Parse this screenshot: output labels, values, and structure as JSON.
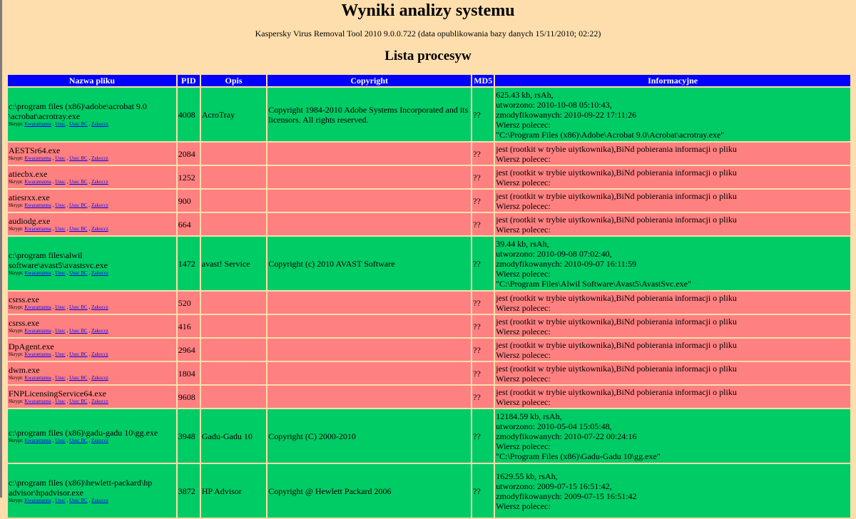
{
  "page": {
    "title": "Wyniki analizy systemu",
    "subtitle": "Kaspersky Virus Removal Tool 2010 9.0.0.722 (data opublikowania bazy danych 15/11/2010; 02:22)",
    "section_title": "Lista procesyw"
  },
  "table": {
    "headers": [
      "Nazwa pliku",
      "PID",
      "Opis",
      "Copyright",
      "MD5",
      "Informacyjne"
    ],
    "script_label": "Skrypt:",
    "actions": [
      "Kwarantanna",
      "Usuc",
      "Usuc BC",
      "Zakoccz"
    ],
    "rows": [
      {
        "status": "ok",
        "file_lines": [
          "c:\\program files (x86)\\adobe\\acrobat 9.0",
          "\\acrobat\\acrotray.exe"
        ],
        "pid": "4008",
        "desc": "AcroTray",
        "copyright": "Copyright 1984-2010 Adobe Systems Incorporated and its licensors. All rights reserved.",
        "md5": "??",
        "info": [
          "625.43 kb, rsAh,",
          "utworzono: 2010-10-08 05:10:43,",
          "zmodyfikowanych: 2010-09-22 17:11:26",
          "Wiersz polecec:",
          "\"C:\\Program Files (x86)\\Adobe\\Acrobat 9.0\\Acrobat\\acrotray.exe\""
        ]
      },
      {
        "status": "bad",
        "file_lines": [
          "AESTSr64.exe"
        ],
        "pid": "2084",
        "desc": "",
        "copyright": "",
        "md5": "??",
        "info": [
          "jest (rootkit w trybie uiytkownika),BiNd pobierania informacji o pliku",
          "Wiersz polecec:"
        ]
      },
      {
        "status": "bad",
        "file_lines": [
          "atiecbx.exe"
        ],
        "pid": "1252",
        "desc": "",
        "copyright": "",
        "md5": "??",
        "info": [
          "jest (rootkit w trybie uiytkownika),BiNd pobierania informacji o pliku",
          "Wiersz polecec:"
        ]
      },
      {
        "status": "bad",
        "file_lines": [
          "atiesrxx.exe"
        ],
        "pid": "900",
        "desc": "",
        "copyright": "",
        "md5": "??",
        "info": [
          "jest (rootkit w trybie uiytkownika),BiNd pobierania informacji o pliku",
          "Wiersz polecec:"
        ]
      },
      {
        "status": "bad",
        "file_lines": [
          "audiodg.exe"
        ],
        "pid": "664",
        "desc": "",
        "copyright": "",
        "md5": "??",
        "info": [
          "jest (rootkit w trybie uiytkownika),BiNd pobierania informacji o pliku",
          "Wiersz polecec:"
        ]
      },
      {
        "status": "ok",
        "file_lines": [
          "c:\\program files\\alwil software\\avast5\\avastsvc.exe"
        ],
        "pid": "1472",
        "desc": "avast! Service",
        "copyright": "Copyright (c) 2010 AVAST Software",
        "md5": "??",
        "info": [
          "39.44 kb, rsAh,",
          "utworzono: 2010-09-08 07:02:40,",
          "zmodyfikowanych: 2010-09-07 16:11:59",
          "Wiersz polecec:",
          "\"C:\\Program Files\\Alwil Software\\Avast5\\AvastSvc.exe\""
        ]
      },
      {
        "status": "bad",
        "file_lines": [
          "csrss.exe"
        ],
        "pid": "520",
        "desc": "",
        "copyright": "",
        "md5": "??",
        "info": [
          "jest (rootkit w trybie uiytkownika),BiNd pobierania informacji o pliku",
          "Wiersz polecec:"
        ]
      },
      {
        "status": "bad",
        "file_lines": [
          "csrss.exe"
        ],
        "pid": "416",
        "desc": "",
        "copyright": "",
        "md5": "??",
        "info": [
          "jest (rootkit w trybie uiytkownika),BiNd pobierania informacji o pliku",
          "Wiersz polecec:"
        ]
      },
      {
        "status": "bad",
        "file_lines": [
          "DpAgent.exe"
        ],
        "pid": "2964",
        "desc": "",
        "copyright": "",
        "md5": "??",
        "info": [
          "jest (rootkit w trybie uiytkownika),BiNd pobierania informacji o pliku",
          "Wiersz polecec:"
        ]
      },
      {
        "status": "bad",
        "file_lines": [
          "dwm.exe"
        ],
        "pid": "1804",
        "desc": "",
        "copyright": "",
        "md5": "??",
        "info": [
          "jest (rootkit w trybie uiytkownika),BiNd pobierania informacji o pliku",
          "Wiersz polecec:"
        ]
      },
      {
        "status": "bad",
        "file_lines": [
          "FNPLicensingService64.exe"
        ],
        "pid": "9608",
        "desc": "",
        "copyright": "",
        "md5": "??",
        "info": [
          "jest (rootkit w trybie uiytkownika),BiNd pobierania informacji o pliku",
          "Wiersz polecec:"
        ]
      },
      {
        "status": "ok",
        "file_lines": [
          "c:\\program files (x86)\\gadu-gadu 10\\gg.exe"
        ],
        "pid": "3948",
        "desc": "Gadu-Gadu 10",
        "copyright": "Copyright (C) 2000-2010",
        "md5": "??",
        "info": [
          "12184.59 kb, rsAh,",
          "utworzono: 2010-05-04 15:05:48,",
          "zmodyfikowanych: 2010-07-22 00:24:16",
          "Wiersz polecec:",
          "\"C:\\Program Files (x86)\\Gadu-Gadu 10\\gg.exe\""
        ]
      },
      {
        "status": "ok",
        "file_lines": [
          "c:\\program files (x86)\\hewlett-packard\\hp",
          "advisor\\hpadvisor.exe"
        ],
        "pid": "3872",
        "desc": "HP Advisor",
        "copyright": "Copyright @ Hewlett Packard 2006",
        "md5": "??",
        "info": [
          "1629.55 kb, rsAh,",
          "utworzono: 2009-07-15 16:51:42,",
          "zmodyfikowanych: 2009-07-15 16:51:42",
          "Wiersz polecec:"
        ]
      }
    ]
  }
}
